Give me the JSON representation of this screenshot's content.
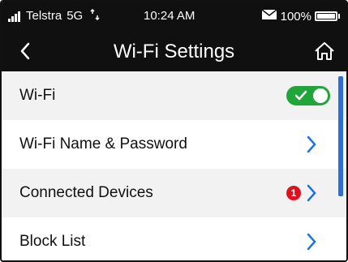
{
  "status_bar": {
    "carrier": "Telstra",
    "network": "5G",
    "time": "10:24 AM",
    "battery": "100%"
  },
  "header": {
    "title": "Wi-Fi Settings"
  },
  "settings": {
    "items": [
      {
        "label": "Wi-Fi",
        "toggle_on": true
      },
      {
        "label": "Wi-Fi Name & Password"
      },
      {
        "label": "Connected Devices",
        "badge": "1"
      },
      {
        "label": "Block List"
      }
    ]
  },
  "colors": {
    "toggle_on": "#1fa53a",
    "badge": "#e0101e",
    "chevron": "#1a73e8",
    "scrollbar": "#2b6fd6",
    "header_bg": "#101010"
  },
  "icons": {
    "back": "chevron-left-icon",
    "home": "home-icon",
    "row_chevron": "chevron-right-icon"
  }
}
